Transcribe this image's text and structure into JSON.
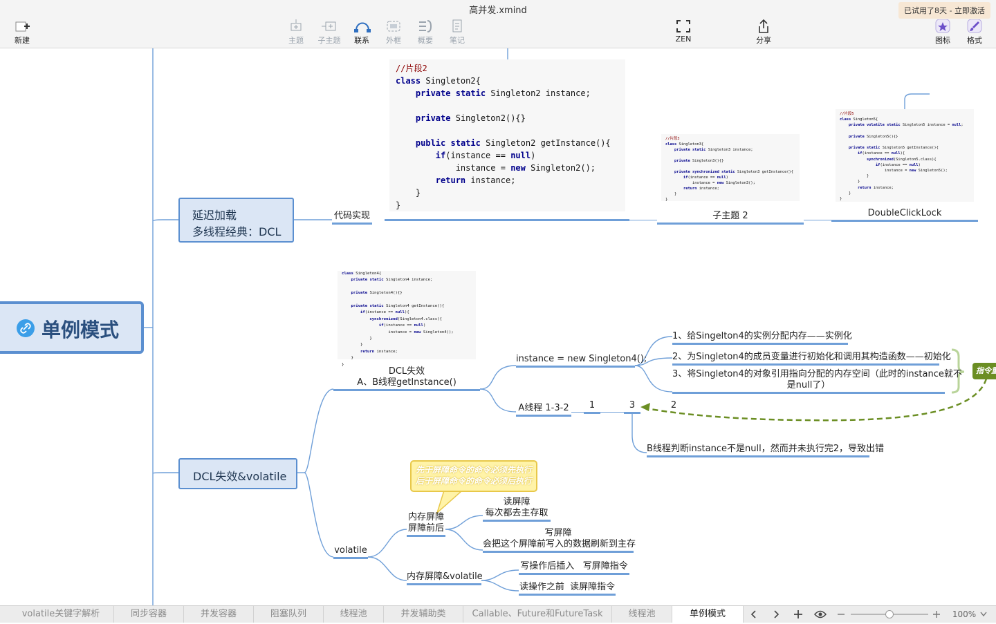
{
  "window": {
    "title": "高并发.xmind",
    "trial_badge": "已试用了8天 - 立即激活"
  },
  "toolbar": {
    "new": "新建",
    "topic": "主题",
    "subtopic": "子主题",
    "relation": "联系",
    "boundary": "外框",
    "summary": "概要",
    "notes": "笔记",
    "zen": "ZEN",
    "share": "分享",
    "icons": "图标",
    "format": "格式"
  },
  "map": {
    "central": "单例模式",
    "branch1": {
      "line1": "延迟加载",
      "line2": "多线程经典：DCL"
    },
    "code_impl": "代码实现",
    "subtopic2": "子主题 2",
    "dcl_lock": "DoubleClickLock",
    "code2": [
      "//片段2",
      "class Singleton2{",
      "    private static Singleton2 instance;",
      "",
      "    private Singleton2(){}",
      "",
      "    public static Singleton2 getInstance(){",
      "        if(instance == null)",
      "            instance = new Singleton2();",
      "        return instance;",
      "    }",
      "}"
    ],
    "code3": [
      "//片段3",
      "class Singleton3{",
      "    private static Singleton3 instance;",
      "",
      "    private Singleton3(){}",
      "",
      "    private synchronized static Singleton3 getInstance(){",
      "        if(instance == null)",
      "            instance = new Singleton3();",
      "        return instance;",
      "    }",
      "}"
    ],
    "code5": [
      "//片段5",
      "class Singleton5{",
      "    private volatile static Singleton5 instance = null;",
      "",
      "    private Singleton5(){}",
      "",
      "    private static Singleton5 getInstance(){",
      "        if(instance == null){",
      "            synchronized(Singleton5.class){",
      "                if(instance == null)",
      "                    instance = new Singleton5();",
      "            }",
      "        }",
      "        return instance;",
      "    }",
      "}"
    ],
    "code4": [
      "class Singleton4{",
      "    private static Singleton4 instance;",
      "",
      "    private Singleton4(){}",
      "",
      "    private static Singleton4 getInstance(){",
      "        if(instance == null){",
      "            synchronized(Singleton4.class){",
      "                if(instance == null)",
      "                    instance = new Singleton4();",
      "            }",
      "        }",
      "        return instance;",
      "    }",
      "}"
    ],
    "branch2": "DCL失效&volatile",
    "dcl_fail": {
      "line1": "DCL失效",
      "line2": "A、B线程getInstance()"
    },
    "new_instance": "instance = new Singleton4();",
    "step1": "1、给Singelton4的实例分配内存——实例化",
    "step2": "2、为Singleton4的成员变量进行初始化和调用其构造函数——初始化",
    "step3": {
      "line1": "3、将Singleton4的对象引用指向分配的内存空间（此时的instance就不",
      "line2": "是null了）"
    },
    "reorder_label": "指令重",
    "thread_a": "A线程 1-3-2",
    "n1": "1",
    "n3": "3",
    "n2": "2",
    "thread_b": "B线程判断instance不是null，然而并未执行完2，导致出错",
    "volatile": "volatile",
    "barrier": {
      "line1": "内存屏障",
      "line2": "屏障前后"
    },
    "callout": {
      "line1": "先于屏障命令的命令必须先执行",
      "line2": "后于屏障命令的命令必须后执行"
    },
    "read_barrier": {
      "line1": "读屏障",
      "line2": "每次都去主存取"
    },
    "write_barrier": {
      "line1": "写屏障",
      "line2": "会把这个屏障前写入的数据刷新到主存"
    },
    "barrier_volatile": "内存屏障&volatile",
    "write_insert": "写操作后插入   写屏障指令",
    "read_insert": "读操作之前  读屏障指令"
  },
  "tabs": [
    "volatile关键字解析",
    "同步容器",
    "并发容器",
    "阻塞队列",
    "线程池",
    "并发辅助类",
    "Callable、Future和FutureTask",
    "线程池",
    "单例模式"
  ],
  "active_tab": "单例模式",
  "zoom": "100%",
  "colors": {
    "accent": "#5b8fd0",
    "branch_line": "#6f9fd8",
    "green": "#6b8e23",
    "callout": "#fff3a8"
  }
}
